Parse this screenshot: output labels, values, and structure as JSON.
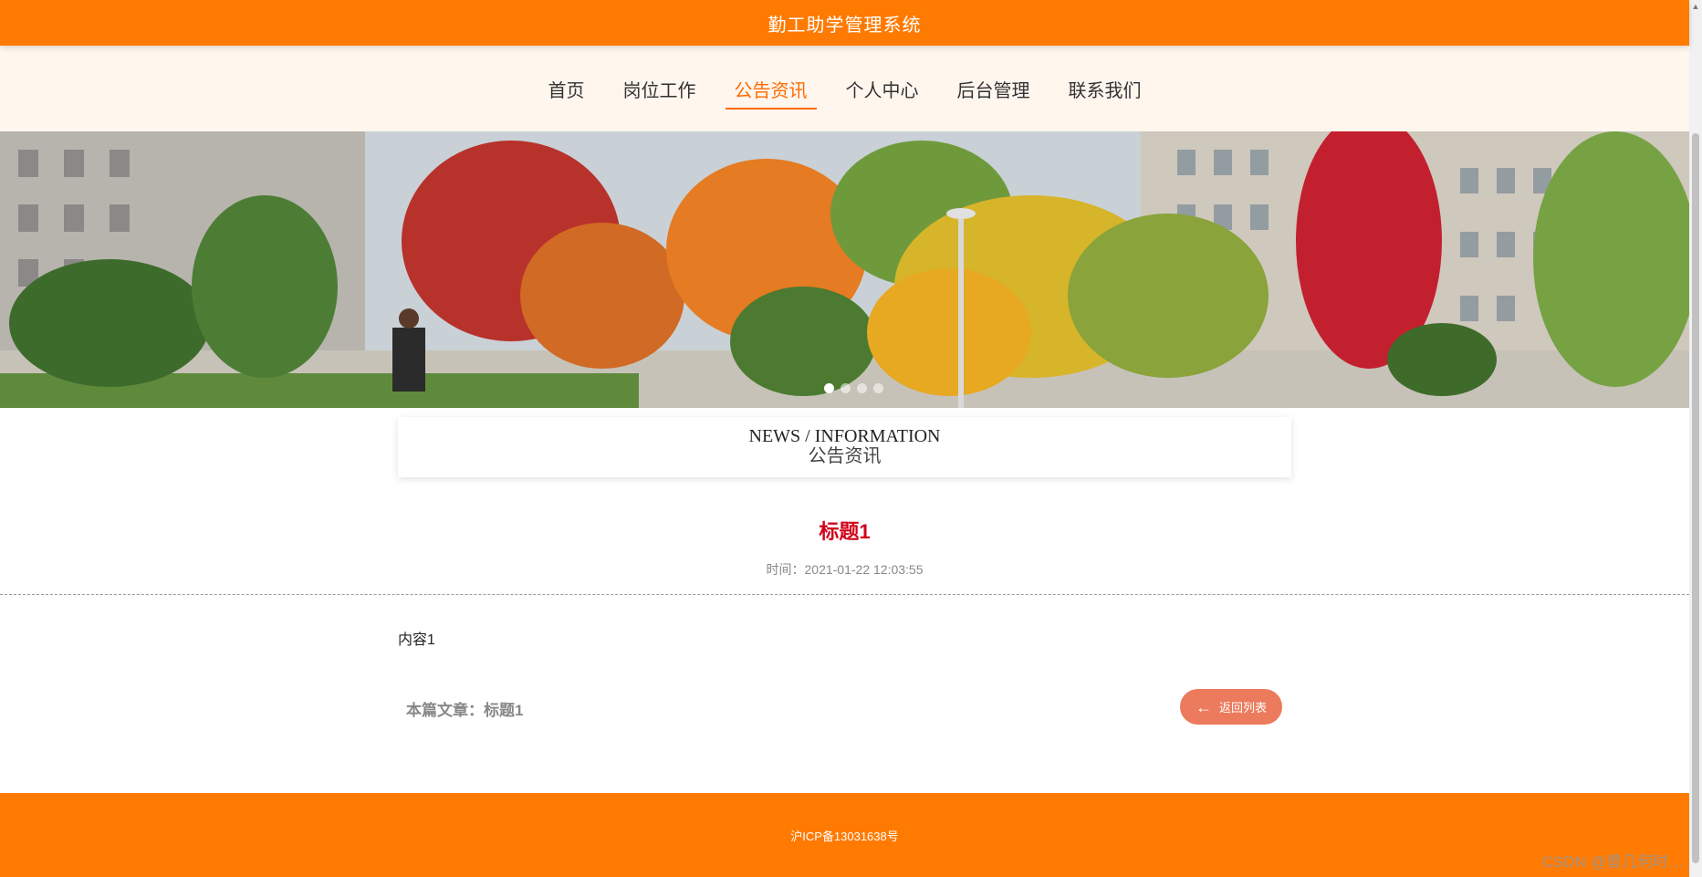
{
  "header": {
    "title": "勤工助学管理系统"
  },
  "nav": {
    "items": [
      {
        "label": "首页"
      },
      {
        "label": "岗位工作"
      },
      {
        "label": "公告资讯"
      },
      {
        "label": "个人中心"
      },
      {
        "label": "后台管理"
      },
      {
        "label": "联系我们"
      }
    ],
    "active_index": 2
  },
  "banner": {
    "slide_count": 4,
    "active_slide": 1
  },
  "section": {
    "title_en": "NEWS / INFORMATION",
    "title_cn": "公告资讯"
  },
  "article": {
    "title": "标题1",
    "time": "时间：2021-01-22 12:03:55",
    "content": "内容1",
    "this_article": "本篇文章：标题1",
    "back_label": "返回列表"
  },
  "footer": {
    "icp": "沪ICP备13031638号"
  },
  "watermark": "CSDN @曾几何时…",
  "colors": {
    "brand": "#ff7a00",
    "title_red": "#d0021b",
    "back_button": "#ec7a5c"
  }
}
